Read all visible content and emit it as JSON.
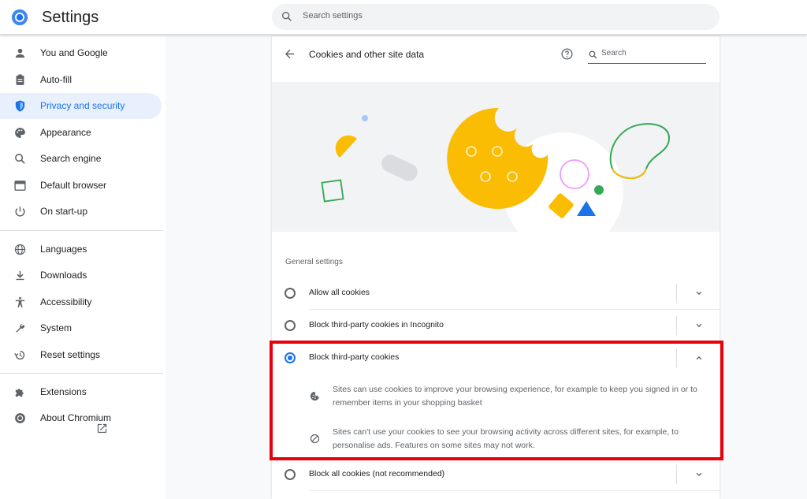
{
  "header": {
    "app_title": "Settings",
    "logo_icon": "chromium-logo-icon",
    "search_placeholder": "Search settings"
  },
  "sidebar": {
    "items": [
      {
        "label": "You and Google",
        "icon": "person-icon",
        "active": false
      },
      {
        "label": "Auto-fill",
        "icon": "clipboard-icon",
        "active": false
      },
      {
        "label": "Privacy and security",
        "icon": "shield-icon",
        "active": true
      },
      {
        "label": "Appearance",
        "icon": "palette-icon",
        "active": false
      },
      {
        "label": "Search engine",
        "icon": "search-icon",
        "active": false
      },
      {
        "label": "Default browser",
        "icon": "browser-icon",
        "active": false
      },
      {
        "label": "On start-up",
        "icon": "power-icon",
        "active": false
      },
      {
        "label": "Languages",
        "icon": "globe-icon",
        "active": false
      },
      {
        "label": "Downloads",
        "icon": "download-icon",
        "active": false
      },
      {
        "label": "Accessibility",
        "icon": "accessibility-icon",
        "active": false
      },
      {
        "label": "System",
        "icon": "wrench-icon",
        "active": false
      },
      {
        "label": "Reset settings",
        "icon": "history-icon",
        "active": false
      },
      {
        "label": "Extensions",
        "icon": "puzzle-icon",
        "active": false
      },
      {
        "label": "About Chromium",
        "icon": "chromium-icon",
        "active": false
      }
    ]
  },
  "content": {
    "title": "Cookies and other site data",
    "search_placeholder": "Search",
    "section_title": "General settings",
    "options": [
      {
        "label": "Allow all cookies",
        "selected": false,
        "expanded": false
      },
      {
        "label": "Block third-party cookies in Incognito",
        "selected": false,
        "expanded": false
      },
      {
        "label": "Block third-party cookies",
        "selected": true,
        "expanded": true
      },
      {
        "label": "Block all cookies (not recommended)",
        "selected": false,
        "expanded": false
      }
    ],
    "details": [
      {
        "icon": "cookie-icon",
        "text": "Sites can use cookies to improve your browsing experience, for example to keep you signed in or to remember items in your shopping basket"
      },
      {
        "icon": "block-icon",
        "text": "Sites can't use your cookies to see your browsing activity across different sites, for example, to personalise ads. Features on some sites may not work."
      }
    ]
  },
  "colors": {
    "accent": "#1a73e8",
    "active_bg": "#e8f0fe",
    "highlight": "#e8000b",
    "cookie_yellow": "#fbbc04",
    "green": "#34a853"
  }
}
